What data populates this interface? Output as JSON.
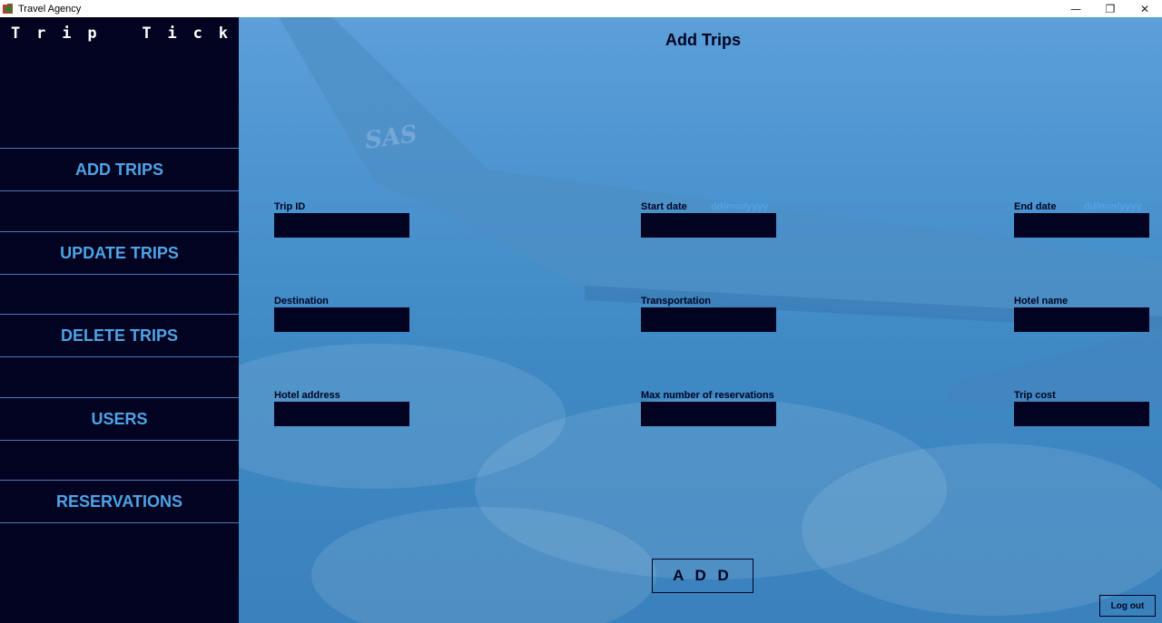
{
  "window": {
    "title": "Travel Agency",
    "minimize_glyph": "—",
    "restore_glyph": "❐",
    "close_glyph": "✕"
  },
  "sidebar": {
    "brand_letters": [
      "T",
      "r",
      "i",
      "p",
      "T",
      "i",
      "c",
      "k"
    ],
    "items": [
      {
        "label": "ADD TRIPS"
      },
      {
        "label": "UPDATE TRIPS"
      },
      {
        "label": "DELETE TRIPS"
      },
      {
        "label": "USERS"
      },
      {
        "label": "RESERVATIONS"
      }
    ]
  },
  "main": {
    "title": "Add Trips",
    "fields": {
      "trip_id": {
        "label": "Trip ID",
        "value": ""
      },
      "start_date": {
        "label": "Start date",
        "hint": "dd/mm/yyyy",
        "value": ""
      },
      "end_date": {
        "label": "End date",
        "hint": "dd/mm/yyyy",
        "value": ""
      },
      "destination": {
        "label": "Destination",
        "value": ""
      },
      "transportation": {
        "label": "Transportation",
        "value": ""
      },
      "hotel_name": {
        "label": "Hotel name",
        "value": ""
      },
      "hotel_address": {
        "label": "Hotel address",
        "value": ""
      },
      "max_reservations": {
        "label": "Max number of reservations",
        "value": ""
      },
      "trip_cost": {
        "label": "Trip cost",
        "value": ""
      }
    },
    "add_label": "A D D",
    "logout_label": "Log out",
    "wing_text": "SAS"
  },
  "colors": {
    "sidebar_bg": "#020320",
    "accent": "#4ea3e6",
    "nav_border": "#4f79b8",
    "input_bg": "#020320",
    "sky": "#4a93cf"
  },
  "icons": {
    "app": "travel-agency-app-icon",
    "minimize": "minimize-icon",
    "restore": "restore-icon",
    "close": "close-icon"
  }
}
